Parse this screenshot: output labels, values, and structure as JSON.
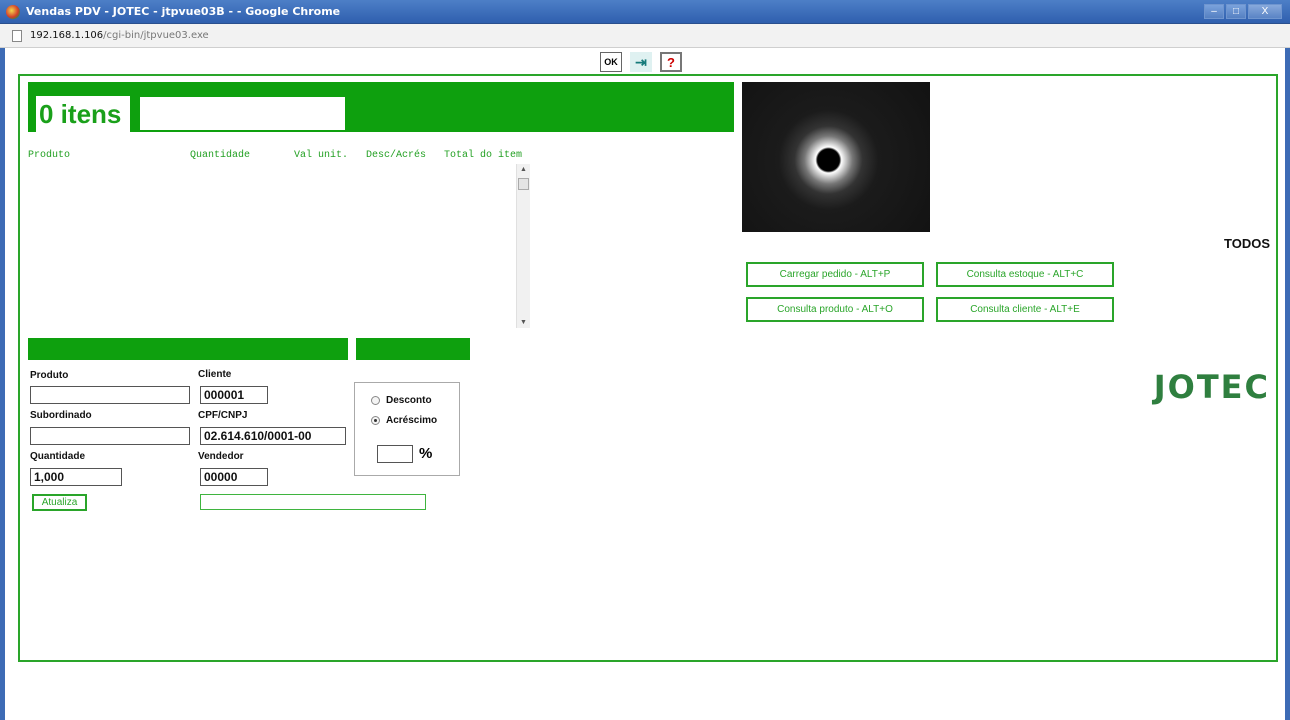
{
  "window": {
    "title": "Vendas PDV - JOTEC - jtpvue03B - - Google Chrome",
    "url_host": "192.168.1.106",
    "url_path": "/cgi-bin/jtpvue03.exe",
    "minimize": "–",
    "maximize": "□",
    "close": "X"
  },
  "toolbar": {
    "ok_label": "OK",
    "exit_label": "⇥",
    "help_label": "?"
  },
  "header": {
    "items_count": "0 itens",
    "item_field": ""
  },
  "columns": [
    "Produto",
    "Quantidade",
    "Val unit.",
    "Desc/Acrés",
    "Total do item"
  ],
  "form": {
    "produto_label": "Produto",
    "produto_value": "",
    "subordinado_label": "Subordinado",
    "subordinado_value": "",
    "quantidade_label": "Quantidade",
    "quantidade_value": "1,000",
    "cliente_label": "Cliente",
    "cliente_value": "000001",
    "cpf_label": "CPF/CNPJ",
    "cpf_value": "02.614.610/0001-00",
    "vendedor_label": "Vendedor",
    "vendedor_value": "00000",
    "atualiza_label": "Atualiza",
    "vendedor_name": ""
  },
  "adjust": {
    "desconto_label": "Desconto",
    "acrescimo_label": "Acréscimo",
    "selected": "Acréscimo",
    "percent_value": "",
    "percent_sign": "%"
  },
  "side": {
    "todos_label": "TODOS",
    "buttons": [
      "Carregar pedido - ALT+P",
      "Consulta estoque - ALT+C",
      "Consulta produto - ALT+O",
      "Consulta cliente - ALT+E"
    ],
    "logo": "JOTEC"
  },
  "colors": {
    "accent": "#0ea00e",
    "border": "#2aa52a",
    "logo": "#2f7f3f"
  }
}
